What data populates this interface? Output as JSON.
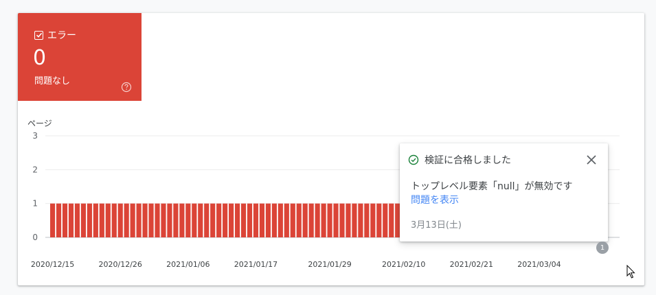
{
  "error_tile": {
    "label": "エラー",
    "count": "0",
    "subtitle": "問題なし",
    "checkbox_checked": true,
    "color": "#db4437",
    "help_icon": "help-circle-icon"
  },
  "tooltip": {
    "title": "検証に合格しました",
    "status_icon": "check-circle-icon",
    "status_color": "#188038",
    "issue": "トップレベル要素「null」が無効です",
    "link": "問題を表示",
    "date": "3月13日(土)",
    "close_icon": "close-icon"
  },
  "annotation_badge": "1",
  "chart_data": {
    "type": "bar",
    "ylabel": "ページ",
    "xlabel": "",
    "ylim": [
      0,
      3
    ],
    "yticks": [
      0,
      1,
      2,
      3
    ],
    "x_tick_labels": [
      "2020/12/15",
      "2020/12/26",
      "2021/01/06",
      "2021/01/17",
      "2021/01/29",
      "2021/02/10",
      "2021/02/21",
      "2021/03/04"
    ],
    "start_date": "2020-12-15",
    "end_date": "2021-03-13",
    "value": 1,
    "bar_color": "#db4437",
    "grid": true
  }
}
